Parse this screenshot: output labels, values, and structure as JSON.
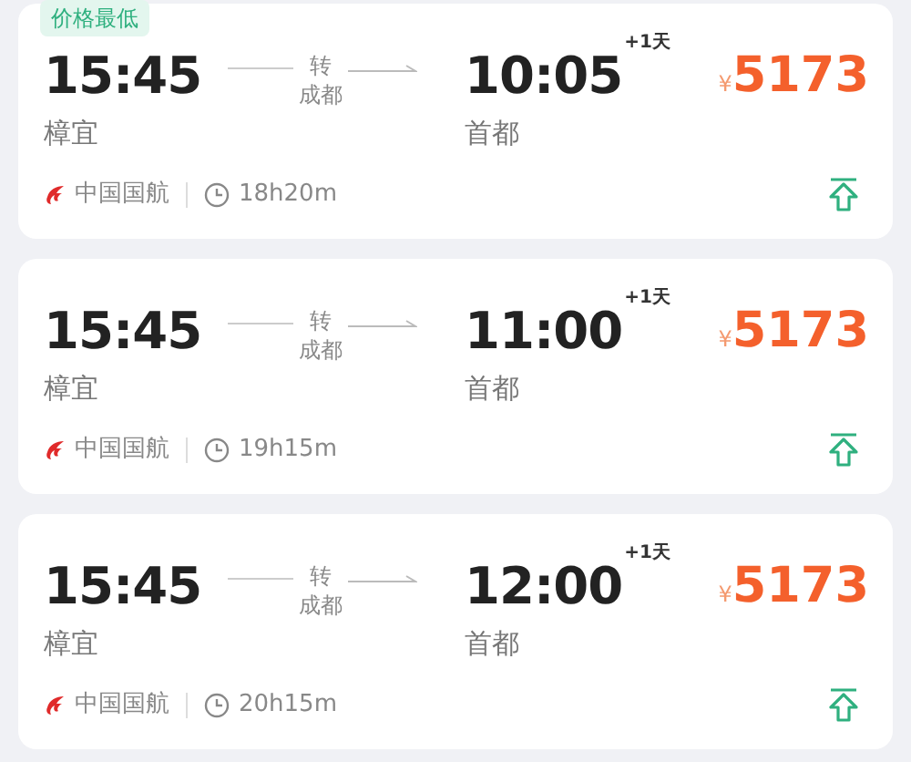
{
  "flights": [
    {
      "badge": "价格最低",
      "depart_time": "15:45",
      "depart_city": "樟宜",
      "via_label": "转",
      "via_city": "成都",
      "arrive_time": "10:05",
      "day_offset": "+1天",
      "arrive_city": "首都",
      "currency": "¥",
      "price": "5173",
      "airline": "中国国航",
      "duration": "18h20m"
    },
    {
      "depart_time": "15:45",
      "depart_city": "樟宜",
      "via_label": "转",
      "via_city": "成都",
      "arrive_time": "11:00",
      "day_offset": "+1天",
      "arrive_city": "首都",
      "currency": "¥",
      "price": "5173",
      "airline": "中国国航",
      "duration": "19h15m"
    },
    {
      "depart_time": "15:45",
      "depart_city": "樟宜",
      "via_label": "转",
      "via_city": "成都",
      "arrive_time": "12:00",
      "day_offset": "+1天",
      "arrive_city": "首都",
      "currency": "¥",
      "price": "5173",
      "airline": "中国国航",
      "duration": "20h15m"
    }
  ]
}
